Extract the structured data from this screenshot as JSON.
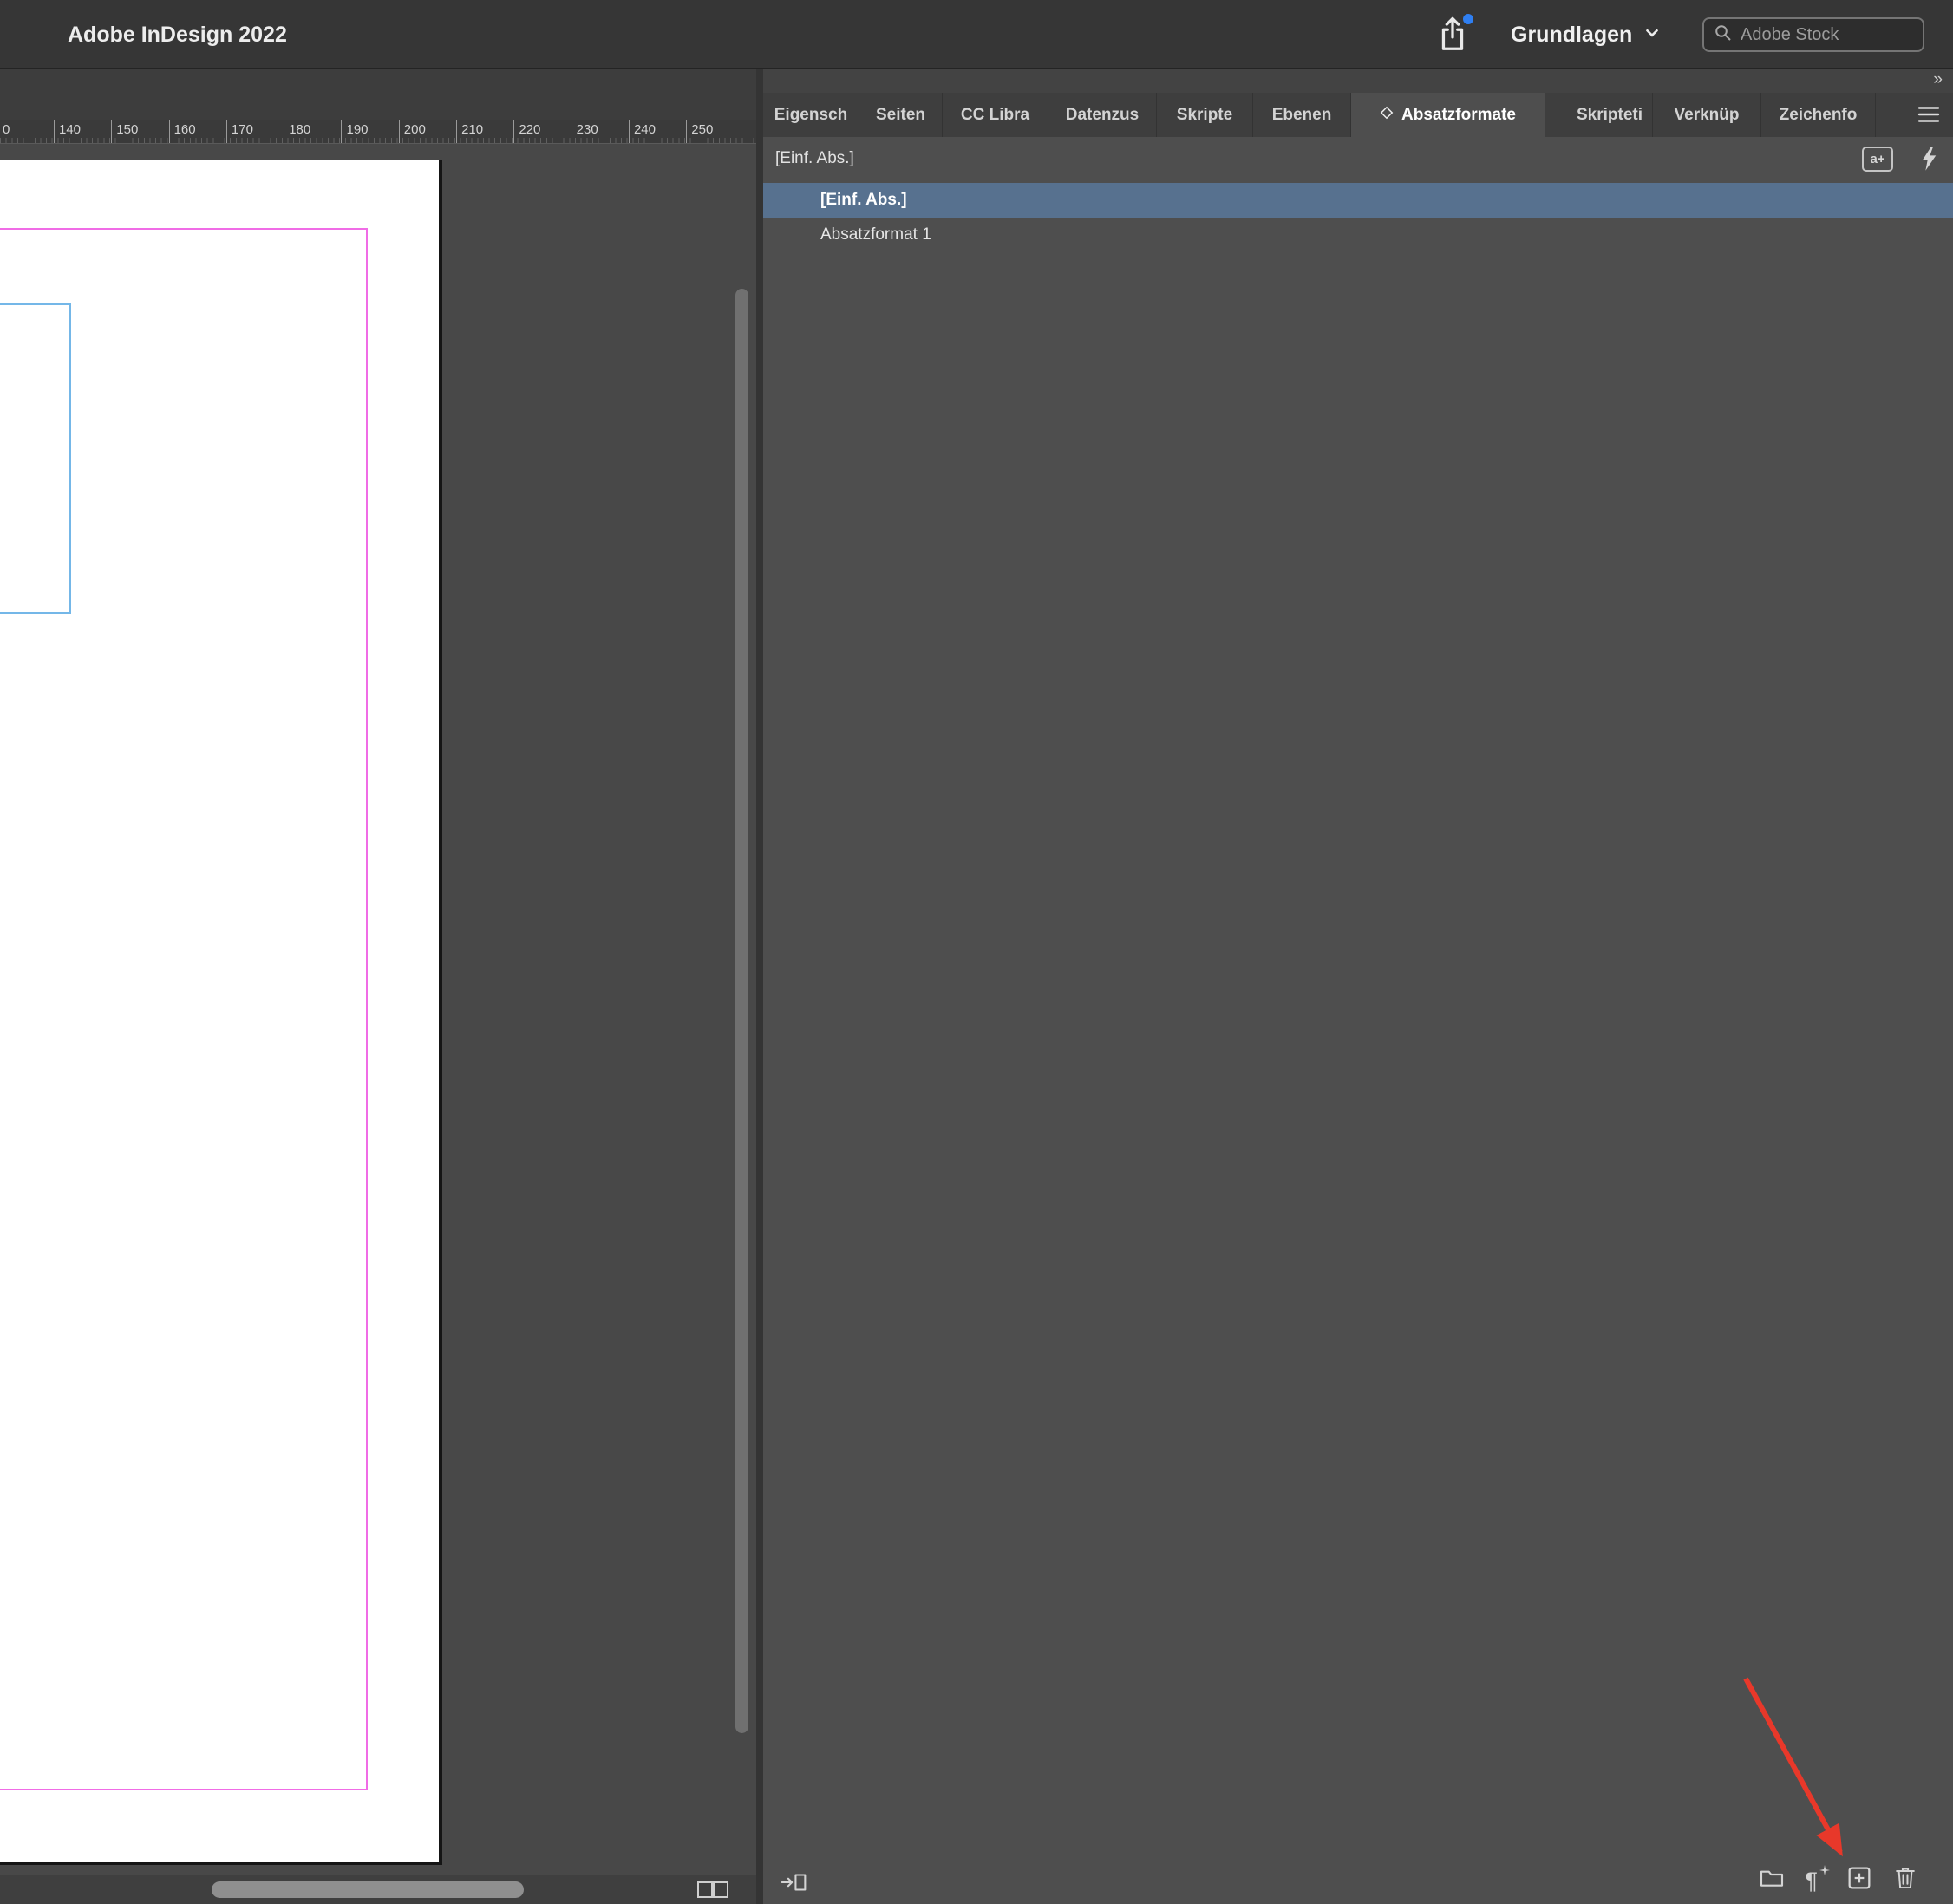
{
  "app": {
    "title": "Adobe InDesign 2022",
    "workspace": "Grundlagen",
    "search_placeholder": "Adobe Stock"
  },
  "ruler": {
    "labels": [
      "0",
      "140",
      "150",
      "160",
      "170",
      "180",
      "190",
      "200",
      "210",
      "220",
      "230",
      "240",
      "250"
    ]
  },
  "panel": {
    "overflow_glyph": "»",
    "tabs": [
      {
        "label": "Eigensch"
      },
      {
        "label": "Seiten"
      },
      {
        "label": "CC Libra"
      },
      {
        "label": "Datenzus"
      },
      {
        "label": "Skripte"
      },
      {
        "label": "Ebenen"
      },
      {
        "label": "Absatzformate"
      },
      {
        "label": "Skripteti"
      },
      {
        "label": "Verknüp"
      },
      {
        "label": "Zeichenfo"
      }
    ],
    "active_tab": "Absatzformate"
  },
  "paragraph_styles": {
    "current_style": "[Einf. Abs.]",
    "new_badge": "a+",
    "items": [
      {
        "name": "[Einf. Abs.]",
        "selected": true
      },
      {
        "name": "Absatzformat 1",
        "selected": false
      }
    ]
  },
  "colors": {
    "selection": "#57718f",
    "margin_guide": "#f06ce6",
    "text_frame": "#74b7e8",
    "annotation_arrow": "#e8382a"
  }
}
